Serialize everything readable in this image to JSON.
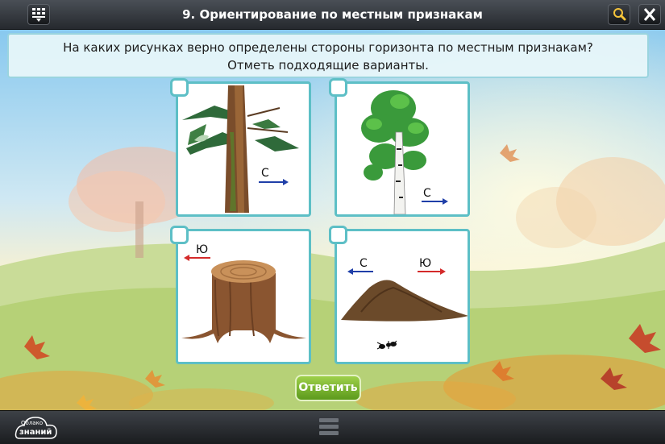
{
  "header": {
    "title": "9. Ориентирование по местным признакам",
    "icons": [
      "grid-menu-icon",
      "search-icon",
      "close-icon"
    ]
  },
  "question": {
    "line1": "На каких рисунках верно определены стороны горизонта по местным признакам?",
    "line2": "Отметь подходящие варианты."
  },
  "options": [
    {
      "label": "С",
      "checked": false,
      "arrow_color": "#1f3fa8"
    },
    {
      "label": "С",
      "checked": false,
      "arrow_color": "#1f3fa8"
    },
    {
      "label": "Ю",
      "checked": false,
      "arrow_color": "#d42a2a"
    },
    {
      "label_left": "С",
      "label_right": "Ю",
      "checked": false,
      "arrow_left_color": "#1f3fa8",
      "arrow_right_color": "#d42a2a"
    }
  ],
  "answer_button": {
    "label": "Ответить",
    "color": "#7cb832"
  },
  "footer": {
    "logo_top": "Облако",
    "logo_bottom": "знаний"
  },
  "colors": {
    "accent": "#5dbfc6",
    "bar": "#2f3338"
  }
}
